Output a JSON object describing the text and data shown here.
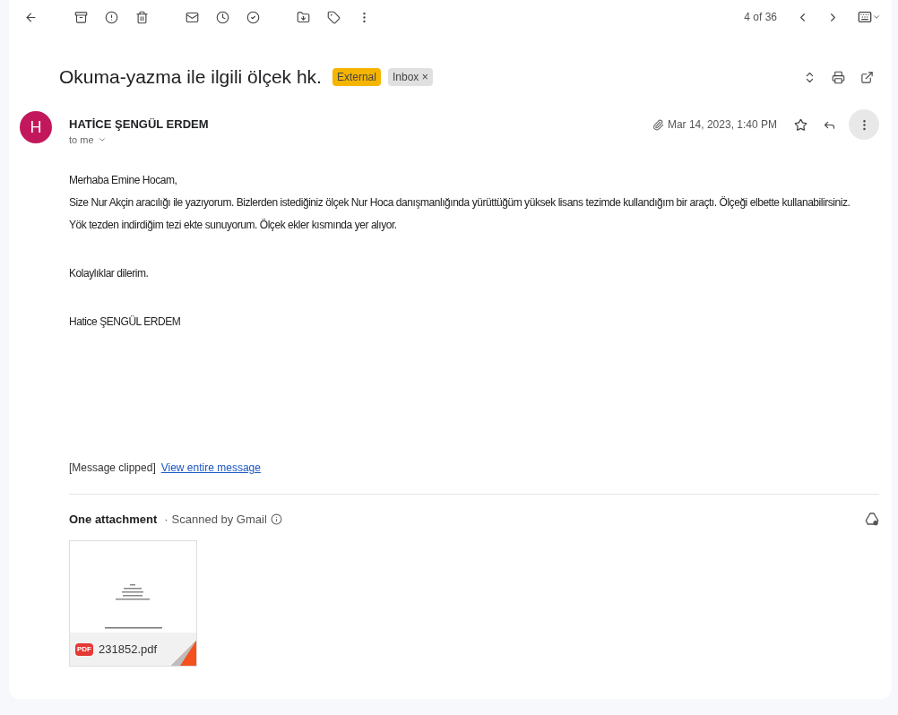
{
  "toolbar": {
    "position": "4 of 36"
  },
  "subject": {
    "title": "Okuma-yazma ile ilgili ölçek hk.",
    "labels": [
      {
        "text": "External",
        "color": "#f5b400"
      },
      {
        "text": "Inbox",
        "color": "#e0e0e0",
        "close": "×"
      }
    ]
  },
  "message": {
    "avatar": "H",
    "sender": "HATİCE ŞENGÜL ERDEM",
    "recipient": "to me",
    "date": "Mar 14, 2023, 1:40 PM",
    "starred": false,
    "body": [
      [
        "Merhaba Emine Hocam,",
        "Size Nur Akçin aracılığı ile yazıyorum. Bizlerden istediğiniz ölçek Nur Hoca danışmanlığında yürüttüğüm yüksek lisans tezimde kullandığım bir araçtı. Ölçeği elbette kullanabilirsiniz.",
        "Yök tezden indirdiğim tezi ekte sunuyorum. Ölçek ekler kısmında yer alıyor."
      ],
      [
        "Kolaylıklar dilerim."
      ],
      [
        "Hatice ŞENGÜL ERDEM"
      ]
    ],
    "clipped": "[Message clipped]",
    "view_link": "View entire message"
  },
  "attachments": {
    "heading": "One attachment",
    "separator": "·",
    "scan": "Scanned by Gmail",
    "files": [
      {
        "name": "231852.pdf",
        "type": "PDF"
      }
    ]
  }
}
